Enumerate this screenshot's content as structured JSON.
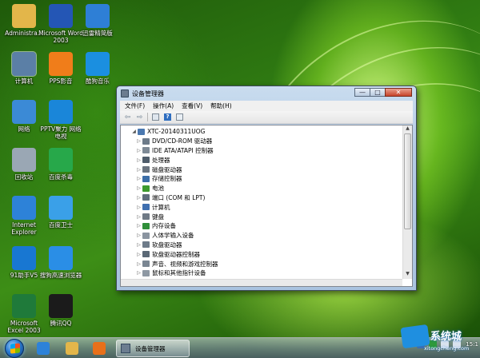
{
  "desktop": {
    "icons": [
      {
        "label": "Administra...",
        "icon": "folder-icon",
        "color": "#e3b64a"
      },
      {
        "label": "Microsoft Word 2003",
        "icon": "word-icon",
        "color": "#2456b5"
      },
      {
        "label": "迅雷精简版",
        "icon": "thunder-icon",
        "color": "#2e7fd6"
      },
      {
        "label": "计算机",
        "icon": "computer-icon",
        "color": "#5b7fa6"
      },
      {
        "label": "PPS影音",
        "icon": "pps-icon",
        "color": "#f07d1a"
      },
      {
        "label": "酷狗音乐",
        "icon": "kugou-icon",
        "color": "#1b8fe0"
      },
      {
        "label": "网络",
        "icon": "network-icon",
        "color": "#3b8ad6"
      },
      {
        "label": "PPTV聚力 网络电视",
        "icon": "pptv-icon",
        "color": "#1a86d9"
      },
      {
        "label": "回收站",
        "icon": "recycle-bin-icon",
        "color": "#9aa7b4"
      },
      {
        "label": "百度杀毒",
        "icon": "baidu-antivirus-icon",
        "color": "#27a84a"
      },
      {
        "label": "Internet Explorer",
        "icon": "ie-icon",
        "color": "#2d82d8"
      },
      {
        "label": "百度卫士",
        "icon": "baidu-guard-icon",
        "color": "#3aa0e8"
      },
      {
        "label": "91助手V5",
        "icon": "91-assistant-icon",
        "color": "#1877d2"
      },
      {
        "label": "搜狗高速浏览器",
        "icon": "sogou-browser-icon",
        "color": "#2a8ee6"
      },
      {
        "label": "Microsoft Excel 2003",
        "icon": "excel-icon",
        "color": "#1f7a3a"
      },
      {
        "label": "腾讯QQ",
        "icon": "qq-icon",
        "color": "#1b1b1b"
      }
    ]
  },
  "window": {
    "title": "设备管理器",
    "buttons": {
      "minimize": "—",
      "maximize": "□",
      "close": "✕"
    },
    "menu": [
      "文件(F)",
      "操作(A)",
      "查看(V)",
      "帮助(H)"
    ],
    "toolbar": [
      "back-arrow-icon",
      "forward-arrow-icon",
      "properties-icon",
      "help-icon",
      "view-icon"
    ],
    "tree": {
      "root": "XTC-20140311UOG",
      "items": [
        {
          "label": "DVD/CD-ROM 驱动器",
          "icon": "dvd-drive-icon",
          "color": "#6d7b89"
        },
        {
          "label": "IDE ATA/ATAPI 控制器",
          "icon": "ide-controller-icon",
          "color": "#7e8a96"
        },
        {
          "label": "处理器",
          "icon": "processor-icon",
          "color": "#4f5d6b"
        },
        {
          "label": "磁盘驱动器",
          "icon": "disk-drive-icon",
          "color": "#6b7580"
        },
        {
          "label": "存储控制器",
          "icon": "storage-controller-icon",
          "color": "#3c6ea8"
        },
        {
          "label": "电池",
          "icon": "battery-icon",
          "color": "#3d9a2e"
        },
        {
          "label": "端口 (COM 和 LPT)",
          "icon": "port-icon",
          "color": "#5f6e7c"
        },
        {
          "label": "计算机",
          "icon": "computer-icon",
          "color": "#3f6fb0"
        },
        {
          "label": "键盘",
          "icon": "keyboard-icon",
          "color": "#6f7a86"
        },
        {
          "label": "内存设备",
          "icon": "memory-icon",
          "color": "#2f8f3a"
        },
        {
          "label": "人体学输入设备",
          "icon": "hid-icon",
          "color": "#8a94a0"
        },
        {
          "label": "软盘驱动器",
          "icon": "floppy-drive-icon",
          "color": "#6d7b89"
        },
        {
          "label": "软盘驱动器控制器",
          "icon": "floppy-controller-icon",
          "color": "#5a6876"
        },
        {
          "label": "声音、视频和游戏控制器",
          "icon": "sound-icon",
          "color": "#7a8692"
        },
        {
          "label": "鼠标和其他指针设备",
          "icon": "mouse-icon",
          "color": "#8e98a3"
        }
      ]
    }
  },
  "taskbar": {
    "pinned": [
      {
        "icon": "ie-taskbar-icon",
        "color": "#2d82d8"
      },
      {
        "icon": "explorer-icon",
        "color": "#e3b64a"
      },
      {
        "icon": "media-player-icon",
        "color": "#e8701a"
      }
    ],
    "active_task": "设备管理器",
    "tray": [
      {
        "icon": "tray-lang-icon",
        "color": "#3a6fb4"
      },
      {
        "icon": "tray-shield-icon",
        "color": "#2e9a3a"
      },
      {
        "icon": "tray-network-icon",
        "color": "#d9e3ee"
      },
      {
        "icon": "tray-volume-icon",
        "color": "#d9e3ee"
      }
    ],
    "clock_time": "15:1",
    "clock_date": ""
  },
  "watermark": {
    "big": "系统城",
    "small": "xitongcheng.com"
  }
}
